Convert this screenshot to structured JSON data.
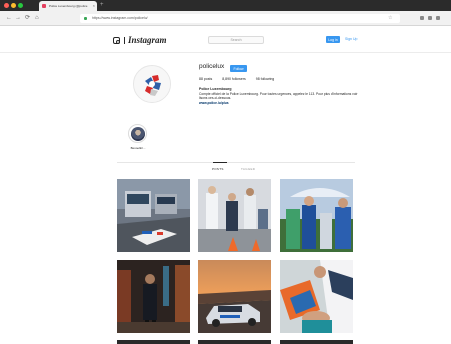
{
  "browser": {
    "tab_title": "Police Luxembourg (@police",
    "tab_close": "×",
    "new_tab": "+",
    "url": "https://www.instagram.com/policelu/",
    "traffic_colors": [
      "#ff5f57",
      "#febc2e",
      "#28c840"
    ]
  },
  "nav": {
    "back": "←",
    "forward": "→",
    "reload": "⟳",
    "home": "⌂",
    "bookmark": "☆"
  },
  "header": {
    "wordmark": "Instagram",
    "search_placeholder": "Search",
    "login": "Log in",
    "signup": "Sign Up"
  },
  "profile": {
    "username": "policelux",
    "follow": "Follow",
    "stats": [
      "88 posts",
      "8,890 followers",
      "98 following"
    ],
    "full_name": "Police Luxembourg",
    "bio": "Compte officiel de la Police Luxembourg. Pour toutes urgences, appelez le 113. Pour plus d'informations voir lisons ces-ci-dessous.",
    "link": "www.police.lu/plus",
    "highlight_label": "Bevoelkri..."
  },
  "tabs": [
    {
      "label": "POSTS",
      "active": true
    },
    {
      "label": "TAGGED",
      "active": false
    }
  ],
  "colors": {
    "accent": "#3897f0",
    "text": "#262626"
  },
  "posts": [
    {
      "name": "post-trucks-highway"
    },
    {
      "name": "post-officers-cones"
    },
    {
      "name": "post-officers-umbrella"
    },
    {
      "name": "post-officer-dark-corridor"
    },
    {
      "name": "post-patrol-car-sunset"
    },
    {
      "name": "post-first-aid"
    }
  ]
}
